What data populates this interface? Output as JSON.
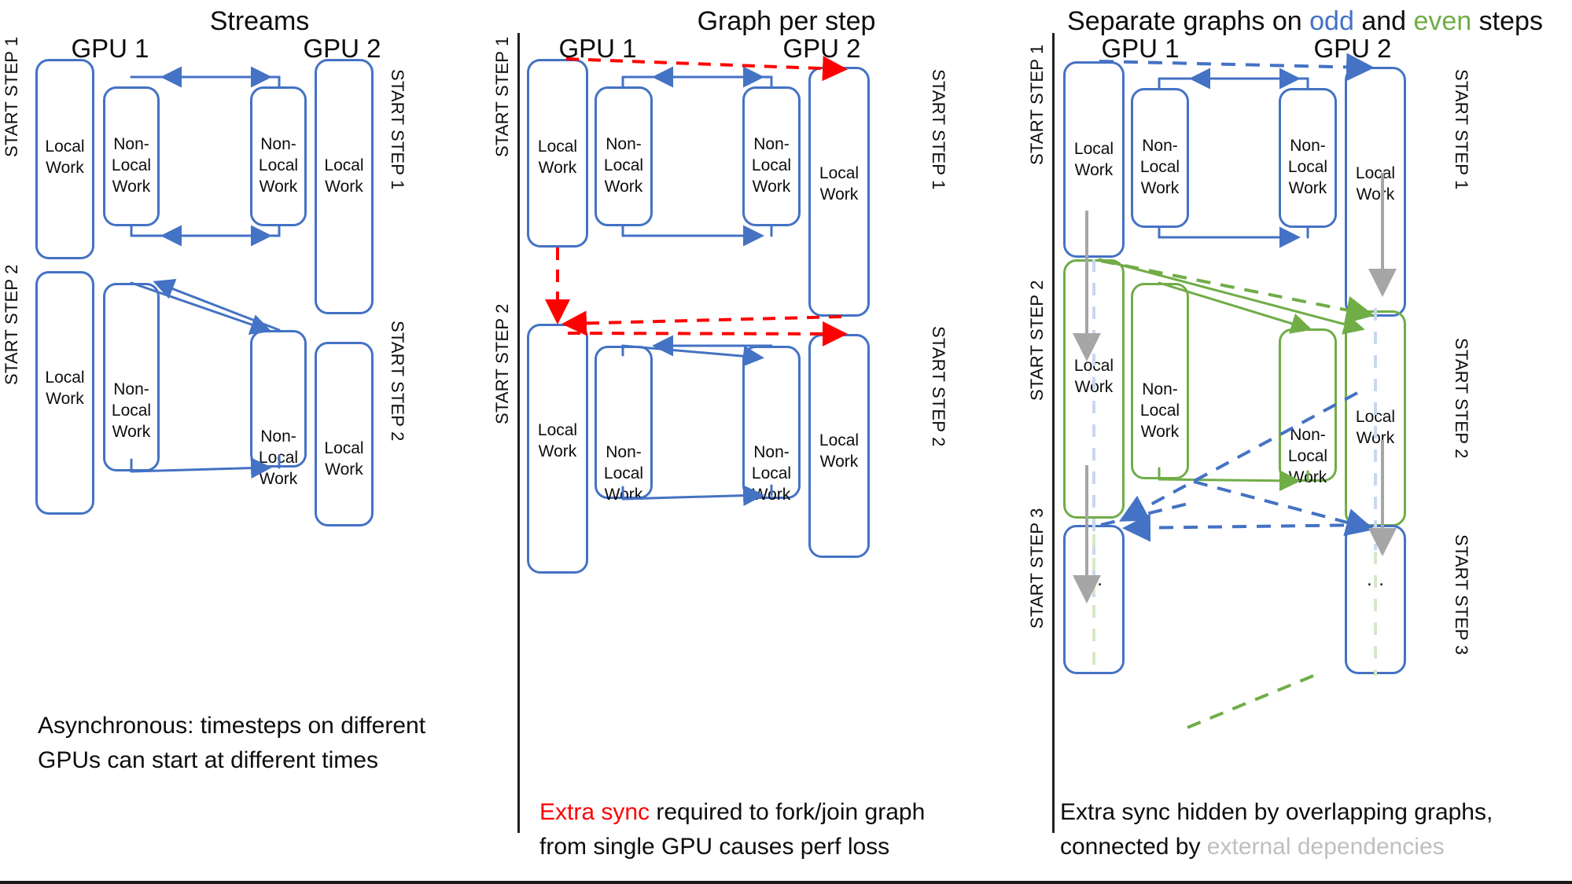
{
  "panels": [
    {
      "id": "streams",
      "title": "Streams",
      "gpu_left": "GPU 1",
      "gpu_right": "GPU 2",
      "steps": [
        "START STEP 1",
        "START STEP 2",
        "START STEP 1",
        "START STEP 2"
      ],
      "box_local": "Local\nWork",
      "box_nonlocal": "Non-\nLocal\nWork",
      "caption_line1": "Asynchronous: timesteps on different",
      "caption_line2": "GPUs can start at different times"
    },
    {
      "id": "graph-per-step",
      "title": "Graph per step",
      "gpu_left": "GPU 1",
      "gpu_right": "GPU 2",
      "steps": [
        "START STEP 1",
        "START STEP 2",
        "START STEP 1",
        "START STEP 2"
      ],
      "box_local": "Local\nWork",
      "box_nonlocal": "Non-\nLocal\nWork",
      "caption_pre": "Extra sync",
      "caption_line1_rest": " required to fork/join graph",
      "caption_line2": "from single GPU causes perf loss"
    },
    {
      "id": "separate-graphs",
      "title_pre": "Separate graphs on ",
      "title_odd": "odd",
      "title_mid": " and ",
      "title_even": "even",
      "title_post": " steps",
      "gpu_left": "GPU 1",
      "gpu_right": "GPU 2",
      "steps": [
        "START STEP 1",
        "START STEP 2",
        "START STEP 3",
        "START STEP 1",
        "START STEP 2",
        "START STEP 3"
      ],
      "box_local": "Local\nWork",
      "box_nonlocal": "Non-\nLocal\nWork",
      "dots": "…",
      "caption_line1": "Extra sync hidden by overlapping graphs,",
      "caption_line2_pre": "connected by ",
      "caption_line2_grey": "external dependencies"
    }
  ],
  "colors": {
    "blue": "#4472C4",
    "green": "#70AD47",
    "red": "#FF0000",
    "grey": "#A6A6A6",
    "light_blue": "#C9D7EF",
    "light_green": "#D5E8C6",
    "black": "#0D0D0D"
  }
}
